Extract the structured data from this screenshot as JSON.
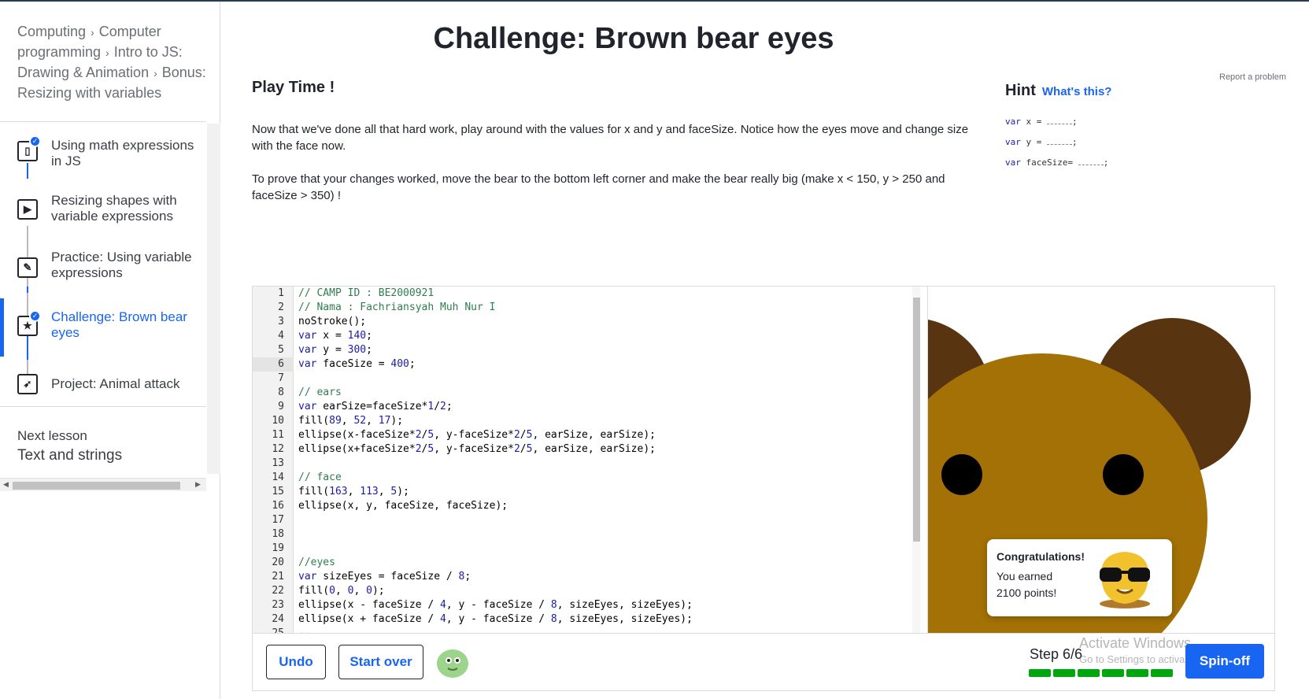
{
  "breadcrumb": {
    "items": [
      "Computing",
      "Computer programming",
      "Intro to JS: Drawing & Animation",
      "Bonus: Resizing with variables"
    ]
  },
  "lessons": [
    {
      "label": "Using math expressions in JS",
      "icon": "article-icon",
      "completed": true
    },
    {
      "label": "Resizing shapes with variable expressions",
      "icon": "video-play-icon",
      "completed": false
    },
    {
      "label": "Practice: Using variable expressions",
      "icon": "pencil-icon",
      "completed": false
    },
    {
      "label": "Challenge: Brown bear eyes",
      "icon": "star-icon",
      "completed": true,
      "active": true
    },
    {
      "label": "Project: Animal attack",
      "icon": "rocket-icon",
      "completed": false
    }
  ],
  "next_lesson": {
    "label": "Next lesson",
    "title": "Text and strings"
  },
  "page": {
    "title": "Challenge: Brown bear eyes",
    "heading": "Play Time !",
    "paragraph1": "Now that we've done all that hard work, play around with the values for x and y and faceSize. Notice how the eyes move and change size with the face now.",
    "paragraph2": "To prove that your changes worked, move the bear to the bottom left corner and make the bear really big (make x < 150, y > 250 and faceSize > 350) !",
    "report": "Report a problem"
  },
  "hint": {
    "title": "Hint",
    "link": "What's this?",
    "lines": [
      {
        "kw": "var",
        "rest": " x = ",
        "end": ";"
      },
      {
        "kw": "var",
        "rest": " y = ",
        "end": ";"
      },
      {
        "kw": "var",
        "rest": " faceSize= ",
        "end": ";"
      }
    ]
  },
  "editor": {
    "current_line": 6,
    "lines": [
      "// CAMP ID : BE2000921",
      "// Nama : Fachriansyah Muh Nur I",
      "noStroke();",
      "var x = 140;",
      "var y = 300;",
      "var faceSize = 400;",
      "",
      "// ears",
      "var earSize=faceSize*1/2;",
      "fill(89, 52, 17);",
      "ellipse(x-faceSize*2/5, y-faceSize*2/5, earSize, earSize);",
      "ellipse(x+faceSize*2/5, y-faceSize*2/5, earSize, earSize);",
      "",
      "// face",
      "fill(163, 113, 5);",
      "ellipse(x, y, faceSize, faceSize);",
      "",
      "",
      "",
      "//eyes",
      "var sizeEyes = faceSize / 8;",
      "fill(0, 0, 0);",
      "ellipse(x - faceSize / 4, y - faceSize / 8, sizeEyes, sizeEyes);",
      "ellipse(x + faceSize / 4, y - faceSize / 8, sizeEyes, sizeEyes);",
      "--"
    ]
  },
  "colors": {
    "ear": "#593411",
    "face": "#a37105",
    "eyes": "#000000",
    "accent": "#1865f2",
    "progress": "#00a60e"
  },
  "toast": {
    "title": "Congratulations!",
    "body": "You earned 2100 points!"
  },
  "toolbar": {
    "undo": "Undo",
    "start_over": "Start over",
    "step": "Step 6/6",
    "steps_total": 6,
    "steps_done": 6,
    "spinoff": "Spin-off"
  },
  "watermark": {
    "line1": "Activate Windows",
    "line2": "Go to Settings to activate Windows."
  }
}
